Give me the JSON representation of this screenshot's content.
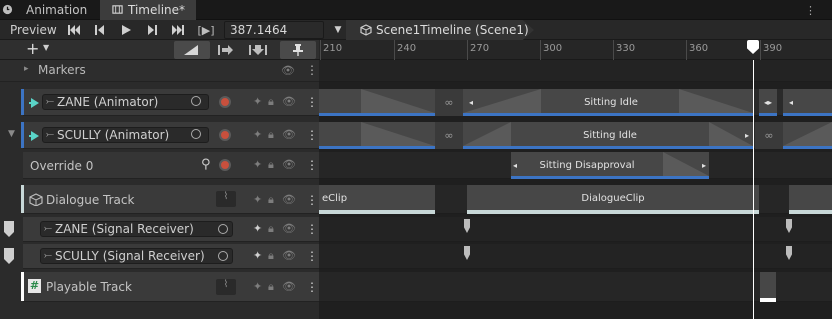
{
  "tabs": [
    {
      "label": "Animation",
      "icon": "clock-icon"
    },
    {
      "label": "Timeline*",
      "icon": "timeline-icon"
    }
  ],
  "toolbar": {
    "preview_label": "Preview",
    "time_value": "387.1464",
    "bracket_label": "[▶]",
    "scene_label": "Scene1Timeline (Scene1)"
  },
  "left_header": {
    "add_label": "+"
  },
  "ruler": {
    "ticks": [
      "210",
      "240",
      "270",
      "300",
      "330",
      "360",
      "390"
    ]
  },
  "markers_row": {
    "label": "Markers"
  },
  "tracks": [
    {
      "name": "ZANE (Animator)",
      "type": "animation"
    },
    {
      "name": "SCULLY (Animator)",
      "type": "animation"
    },
    {
      "name": "Override 0",
      "type": "override"
    },
    {
      "name": "Dialogue Track",
      "type": "dialogue"
    },
    {
      "name": "ZANE (Signal Receiver)",
      "type": "signal"
    },
    {
      "name": "SCULLY (Signal Receiver)",
      "type": "signal"
    },
    {
      "name": "Playable Track",
      "type": "playable"
    }
  ],
  "clips": {
    "zane_clip": "Sitting Idle",
    "scully_clip": "Sitting Idle",
    "override_clip": "Sitting Disapproval",
    "dialogue_clip_left": "eClip",
    "dialogue_clip": "DialogueClip"
  },
  "colors": {
    "animation_accent": "#3c74c4",
    "dialogue_accent": "#c8d8d8",
    "playable_accent": "#ffffff",
    "record": "#c8503d"
  }
}
